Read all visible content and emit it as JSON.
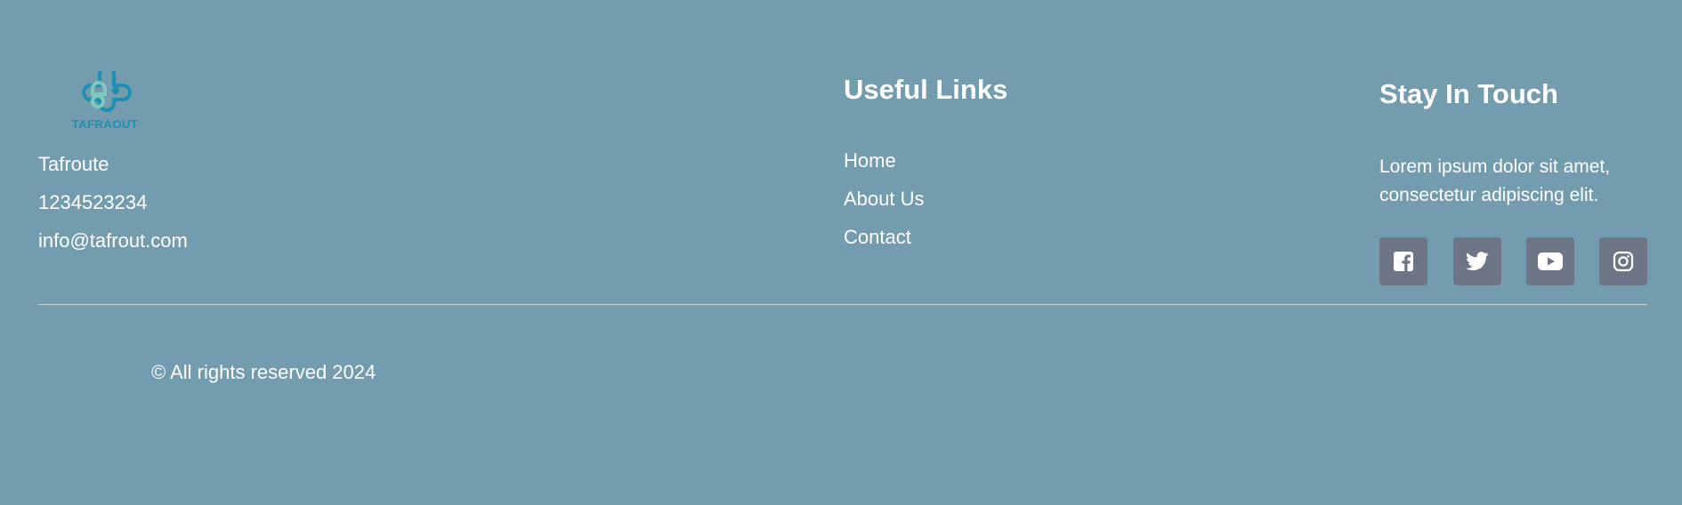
{
  "brand": {
    "logo_text": "TAFRAOUT"
  },
  "contact": {
    "name": "Tafroute",
    "phone": "1234523234",
    "email": "info@tafrout.com"
  },
  "useful_links": {
    "title": "Useful Links",
    "items": [
      {
        "label": "Home"
      },
      {
        "label": "About Us"
      },
      {
        "label": "Contact"
      }
    ]
  },
  "stay_in_touch": {
    "title": "Stay In Touch",
    "text": "Lorem ipsum dolor sit amet, consectetur adipiscing elit.",
    "socials": [
      {
        "icon": "facebook-icon"
      },
      {
        "icon": "twitter-icon"
      },
      {
        "icon": "youtube-icon"
      },
      {
        "icon": "instagram-icon"
      }
    ]
  },
  "copyright": "© All rights reserved 2024",
  "colors": {
    "background": "#739cae",
    "social_button": "#6c7686",
    "logo_teal": "#1f8fb0",
    "logo_mint": "#7fc8c0",
    "divider": "#c9dbe3"
  }
}
